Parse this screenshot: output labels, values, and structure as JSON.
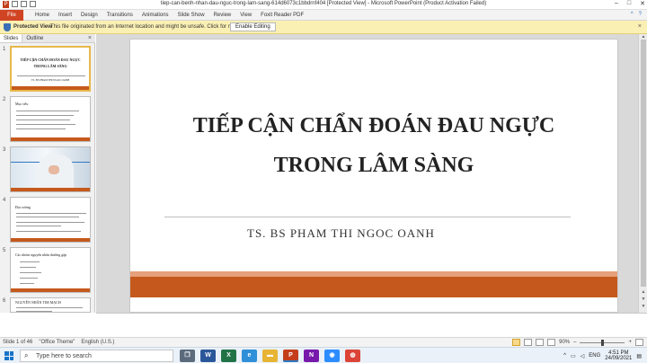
{
  "window": {
    "title": "tiep-can-benh-nhan-dau-nguc-trong-lam-sang-614d6073c1bbdrnf404 [Protected View] - Microsoft PowerPoint (Product Activation Failed)",
    "qat_icon": "P",
    "minimize": "–",
    "maximize": "□",
    "close": "✕"
  },
  "ribbon": {
    "file_label": "File",
    "tabs": [
      "Home",
      "Insert",
      "Design",
      "Transitions",
      "Animations",
      "Slide Show",
      "Review",
      "View",
      "Foxit Reader PDF"
    ],
    "help": "?",
    "expand": "^"
  },
  "protected_view": {
    "label": "Protected View",
    "message": "This file originated from an Internet location and might be unsafe. Click for more details.",
    "button": "Enable Editing",
    "close": "×"
  },
  "slides_pane": {
    "tabs": [
      "Slides",
      "Outline"
    ],
    "close": "×",
    "numbers": [
      "1",
      "2",
      "3",
      "4",
      "5",
      "6"
    ],
    "thumb1_title_l1": "TIẾP CẬN CHẨN ĐOÁN ĐAU NGỰC",
    "thumb1_title_l2": "TRONG LÂM SÀNG",
    "thumb1_author": "TS. BS PHẠM THỊ NGỌC OANH",
    "thumb2_heading": "Mục tiêu",
    "thumb4_heading": "Đại cương",
    "thumb5_heading": "Các nhóm nguyên nhân thường gặp",
    "thumb6_heading": "NGUYÊN NHÂN TIM MẠCH"
  },
  "slide": {
    "title_line1": "TIẾP CẬN CHẨN ĐOÁN ĐAU NGỰC",
    "title_line2": "TRONG LÂM SÀNG",
    "author": "TS. BS PHAM THI NGOC OANH"
  },
  "status_bar": {
    "slide_counter": "Slide 1 of 46",
    "theme": "\"Office Theme\"",
    "language": "English (U.S.)",
    "zoom": "90%",
    "minus": "–",
    "plus": "+"
  },
  "taskbar": {
    "search_placeholder": "Type here to search",
    "apps": [
      {
        "name": "task-view",
        "glyph": "❐",
        "color": "#5b6b7c"
      },
      {
        "name": "word",
        "glyph": "W",
        "color": "#2b579a"
      },
      {
        "name": "excel",
        "glyph": "X",
        "color": "#217346"
      },
      {
        "name": "edge",
        "glyph": "e",
        "color": "#2f8fd8"
      },
      {
        "name": "file-explorer",
        "glyph": "▬",
        "color": "#e8b433"
      },
      {
        "name": "powerpoint",
        "glyph": "P",
        "color": "#c43e1c"
      },
      {
        "name": "onenote",
        "glyph": "N",
        "color": "#7719aa"
      },
      {
        "name": "zoom",
        "glyph": "◉",
        "color": "#2d8cff"
      },
      {
        "name": "chrome",
        "glyph": "◍",
        "color": "#db4437"
      }
    ],
    "lang": "ENG",
    "time": "4:51 PM",
    "date": "24/09/2021"
  },
  "colors": {
    "accent_orange": "#c5581d",
    "accent_light": "#e6a07a",
    "file_tab": "#d04423",
    "protected_bar": "#fbf0b4"
  }
}
